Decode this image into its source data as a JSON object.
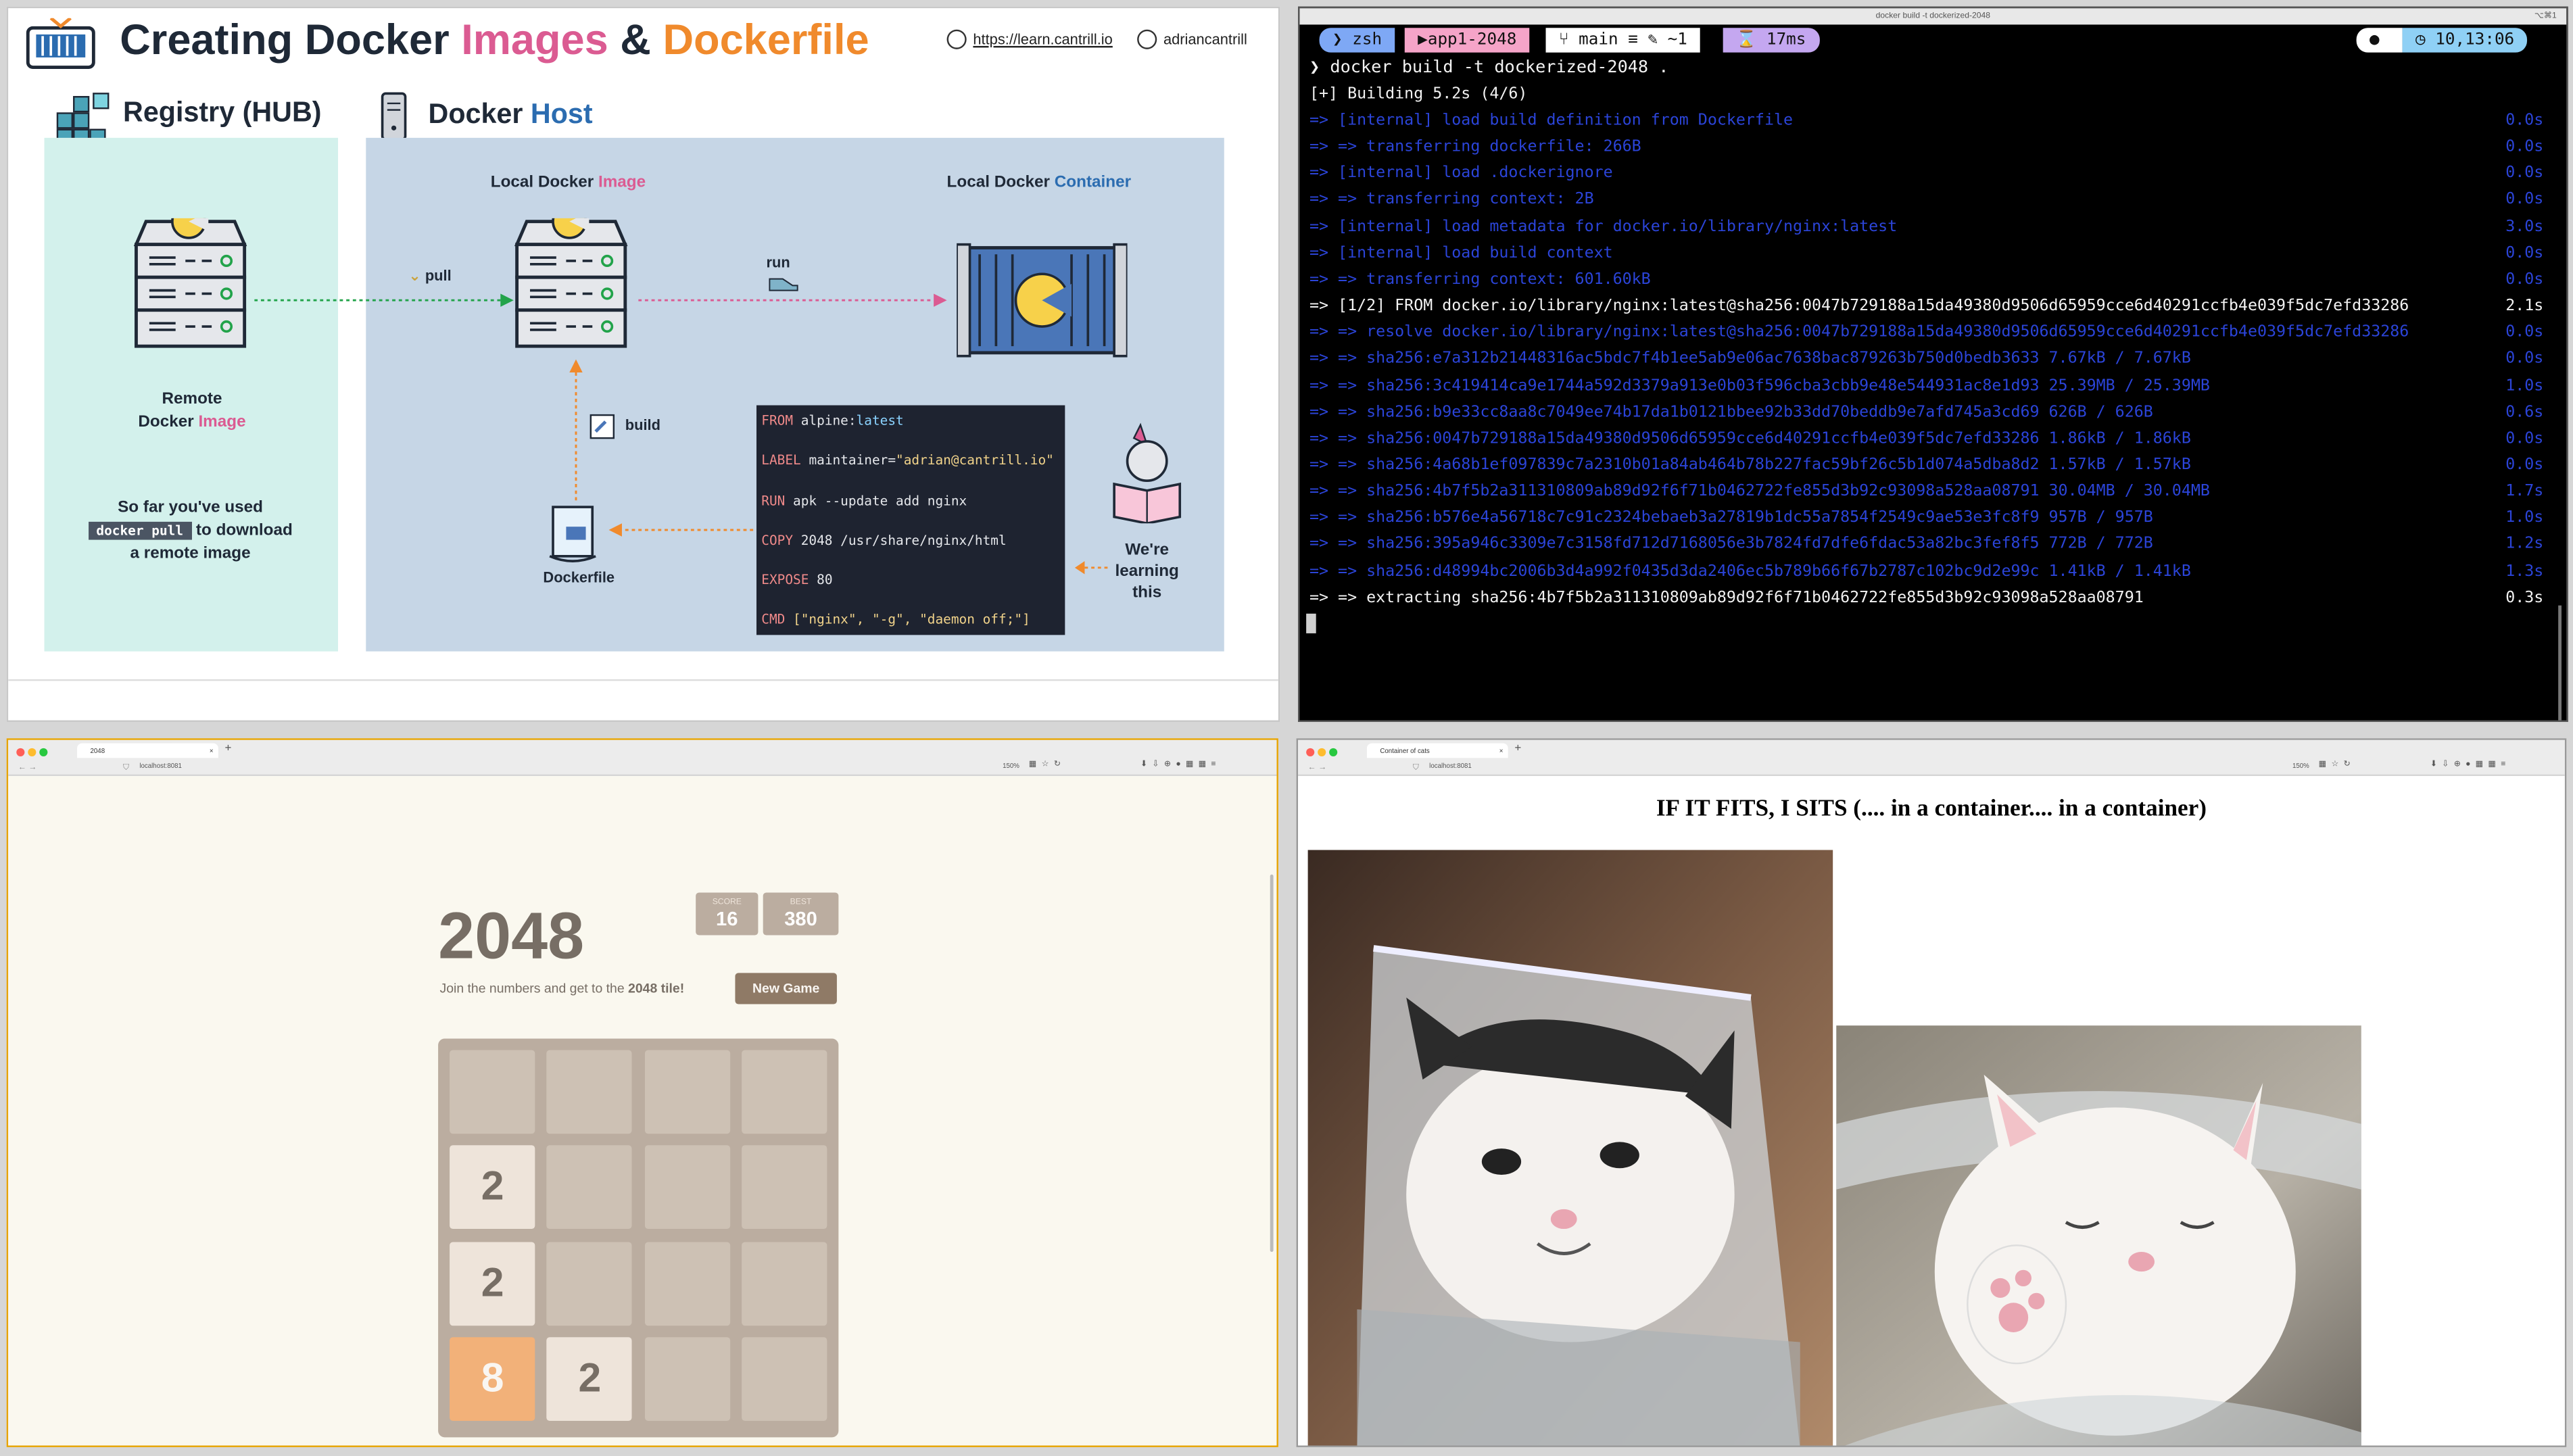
{
  "slide": {
    "title_prefix": "Creating Docker ",
    "title_images": "Images",
    "title_amp": " & ",
    "title_dockerfile": "Dockerfile",
    "link": "https://learn.cantrill.io",
    "handle": "adriancantrill",
    "registry_header": "Registry (HUB)",
    "host_header_prefix": "Docker ",
    "host_header_host": "Host",
    "local_image_prefix": "Local Docker ",
    "local_image_word": "Image",
    "local_container_prefix": "Local Docker ",
    "local_container_word": "Container",
    "pull_label": "pull",
    "run_label": "run",
    "build_label": "build",
    "remote_line1": "Remote",
    "remote_line2_prefix": "Docker ",
    "remote_line2_word": "Image",
    "note_line1": "So far you've used",
    "note_code": "docker pull",
    "note_line2": "to download",
    "note_line3": "a remote image",
    "dockerfile_label": "Dockerfile",
    "learning_line1": "We're",
    "learning_line2": "learning",
    "learning_line3": "this",
    "code_lines": [
      {
        "kw": "FROM",
        "rest": " alpine:",
        "extra": "latest"
      },
      {
        "kw": "LABEL",
        "rest": " maintainer=",
        "extra": "\"adrian@cantrill.io\""
      },
      {
        "kw": "RUN",
        "rest": " apk --update add nginx",
        "extra": ""
      },
      {
        "kw": "COPY",
        "rest": " 2048 /usr/share/nginx/html",
        "extra": ""
      },
      {
        "kw": "EXPOSE",
        "rest": " 80",
        "extra": ""
      },
      {
        "kw": "CMD",
        "rest": " [\"nginx\", \"-g\", \"daemon off;\"]",
        "extra": ""
      }
    ],
    "colors": {
      "pink": "#db5b92",
      "orange": "#f08a2c",
      "blue": "#2b6cb0"
    }
  },
  "terminal": {
    "window_title": "docker build -t dockerized-2048",
    "size_badge": "⌥⌘1",
    "prompt_shell": "zsh",
    "prompt_dir": "app1-2048",
    "prompt_git": "main ≡ ✎ ~1",
    "prompt_time_taken": "17ms",
    "prompt_clock": "10,13:06",
    "command": "docker build -t dockerized-2048 .",
    "building": "[+] Building 5.2s (4/6)",
    "lines": [
      {
        "text": "=> [internal] load build definition from Dockerfile",
        "time": "0.0s",
        "color": "blue"
      },
      {
        "text": "=> => transferring dockerfile: 266B",
        "time": "0.0s",
        "color": "blue"
      },
      {
        "text": "=> [internal] load .dockerignore",
        "time": "0.0s",
        "color": "blue"
      },
      {
        "text": "=> => transferring context: 2B",
        "time": "0.0s",
        "color": "blue"
      },
      {
        "text": "=> [internal] load metadata for docker.io/library/nginx:latest",
        "time": "3.0s",
        "color": "blue"
      },
      {
        "text": "=> [internal] load build context",
        "time": "0.0s",
        "color": "blue"
      },
      {
        "text": "=> => transferring context: 601.60kB",
        "time": "0.0s",
        "color": "blue"
      },
      {
        "text": "=> [1/2] FROM docker.io/library/nginx:latest@sha256:0047b729188a15da49380d9506d65959cce6d40291ccfb4e039f5dc7efd33286",
        "time": "2.1s",
        "color": "white"
      },
      {
        "text": "=> => resolve docker.io/library/nginx:latest@sha256:0047b729188a15da49380d9506d65959cce6d40291ccfb4e039f5dc7efd33286",
        "time": "0.0s",
        "color": "blue"
      },
      {
        "text": "=> => sha256:e7a312b21448316ac5bdc7f4b1ee5ab9e06ac7638bac879263b750d0bedb3633 7.67kB / 7.67kB",
        "time": "0.0s",
        "color": "blue"
      },
      {
        "text": "=> => sha256:3c419414ca9e1744a592d3379a913e0b03f596cba3cbb9e48e544931ac8e1d93 25.39MB / 25.39MB",
        "time": "1.0s",
        "color": "blue"
      },
      {
        "text": "=> => sha256:b9e33cc8aa8c7049ee74b17da1b0121bbee92b33dd70beddb9e7afd745a3cd69 626B / 626B",
        "time": "0.6s",
        "color": "blue"
      },
      {
        "text": "=> => sha256:0047b729188a15da49380d9506d65959cce6d40291ccfb4e039f5dc7efd33286 1.86kB / 1.86kB",
        "time": "0.0s",
        "color": "blue"
      },
      {
        "text": "=> => sha256:4a68b1ef097839c7a2310b01a84ab464b78b227fac59bf26c5b1d074a5dba8d2 1.57kB / 1.57kB",
        "time": "0.0s",
        "color": "blue"
      },
      {
        "text": "=> => sha256:4b7f5b2a311310809ab89d92f6f71b0462722fe855d3b92c93098a528aa08791 30.04MB / 30.04MB",
        "time": "1.7s",
        "color": "blue"
      },
      {
        "text": "=> => sha256:b576e4a56718c7c91c2324bebaeb3a27819b1dc55a7854f2549c9ae53e3fc8f9 957B / 957B",
        "time": "1.0s",
        "color": "blue"
      },
      {
        "text": "=> => sha256:395a946c3309e7c3158fd712d7168056e3b7824fd7dfe6fdac53a82bc3fef8f5 772B / 772B",
        "time": "1.2s",
        "color": "blue"
      },
      {
        "text": "=> => sha256:d48994bc2006b3d4a992f0435d3da2406ec5b789b66f67b2787c102bc9d2e99c 1.41kB / 1.41kB",
        "time": "1.3s",
        "color": "blue"
      },
      {
        "text": "=> => extracting sha256:4b7f5b2a311310809ab89d92f6f71b0462722fe855d3b92c93098a528aa08791",
        "time": "0.3s",
        "color": "white"
      }
    ],
    "colors": {
      "blue": "#2b44d8",
      "white": "#f2f2f2",
      "pill_shell": "#7ea8f5",
      "pill_dir": "#f5a4c8",
      "pill_git": "#ffffff",
      "pill_time": "#c4a7f0",
      "pill_clock": "#8fd0f5"
    }
  },
  "game_browser": {
    "tab_title": "2048",
    "url": "localhost:8081",
    "zoom": "150%",
    "title": "2048",
    "score_label": "SCORE",
    "score": "16",
    "best_label": "BEST",
    "best": "380",
    "subtitle_prefix": "Join the numbers and get to the ",
    "subtitle_bold": "2048 tile!",
    "new_game": "New Game",
    "grid": [
      [
        "",
        "",
        "",
        ""
      ],
      [
        "2",
        "",
        "",
        ""
      ],
      [
        "2",
        "",
        "",
        ""
      ],
      [
        "8",
        "2",
        "",
        ""
      ]
    ],
    "tile_colors": {
      "2": "#eee4da",
      "8": "#f2b179"
    }
  },
  "cat_browser": {
    "tab_title": "Container of cats",
    "url": "localhost:8081",
    "zoom": "150%",
    "heading": "IF IT FITS, I SITS (.... in a container.... in a container)"
  }
}
